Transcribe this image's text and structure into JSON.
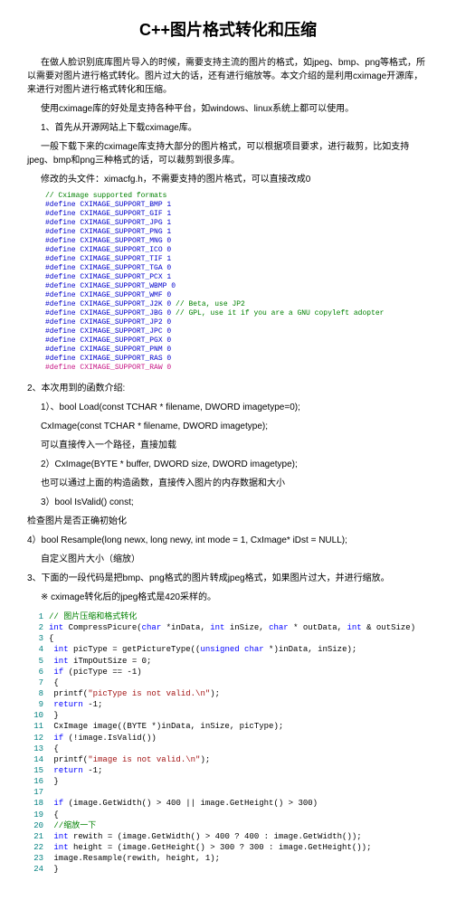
{
  "title": "C++图片格式转化和压缩",
  "intro1": "在做人脸识别底库图片导入的时候，需要支持主流的图片的格式，如jpeg、bmp、png等格式，所以需要对图片进行格式转化。图片过大的话，还有进行缩放等。本文介绍的是利用cximage开源库，来进行对图片进行格式转化和压缩。",
  "intro2": "使用cximage库的好处是支持各种平台，如windows、linux系统上都可以使用。",
  "step1": "1、首先从开源网站上下载cximage库。",
  "step1_note": "一般下载下来的cximage库支持大部分的图片格式，可以根据项目要求，进行裁剪，比如支持jpeg、bmp和png三种格式的话，可以裁剪到很多库。",
  "step1_modify": "修改的头文件：ximacfg.h，不需要支持的图片格式，可以直接改成0",
  "defines": [
    {
      "t": "// Cximage supported formats",
      "cls": "d-green"
    },
    {
      "t": "#define CXIMAGE_SUPPORT_BMP 1",
      "cls": "d-blue"
    },
    {
      "t": "#define CXIMAGE_SUPPORT_GIF 1",
      "cls": "d-blue"
    },
    {
      "t": "#define CXIMAGE_SUPPORT_JPG 1",
      "cls": "d-blue"
    },
    {
      "t": "#define CXIMAGE_SUPPORT_PNG 1",
      "cls": "d-blue"
    },
    {
      "t": "#define CXIMAGE_SUPPORT_MNG 0",
      "cls": "d-blue"
    },
    {
      "t": "#define CXIMAGE_SUPPORT_ICO 0",
      "cls": "d-blue"
    },
    {
      "t": "#define CXIMAGE_SUPPORT_TIF 1",
      "cls": "d-blue"
    },
    {
      "t": "#define CXIMAGE_SUPPORT_TGA 0",
      "cls": "d-blue"
    },
    {
      "t": "#define CXIMAGE_SUPPORT_PCX 1",
      "cls": "d-blue"
    },
    {
      "t": "#define CXIMAGE_SUPPORT_WBMP 0",
      "cls": "d-blue"
    },
    {
      "t": "#define CXIMAGE_SUPPORT_WMF 0",
      "cls": "d-blue"
    },
    {
      "t": "#define CXIMAGE_SUPPORT_J2K 0",
      "cls": "d-blue",
      "extra": "// Beta, use JP2"
    },
    {
      "t": "#define CXIMAGE_SUPPORT_JBG 0",
      "cls": "d-blue",
      "extra": "// GPL, use it if you are a GNU copyleft adopter"
    },
    {
      "t": "#define CXIMAGE_SUPPORT_JP2 0",
      "cls": "d-blue"
    },
    {
      "t": "#define CXIMAGE_SUPPORT_JPC 0",
      "cls": "d-blue"
    },
    {
      "t": "#define CXIMAGE_SUPPORT_PGX 0",
      "cls": "d-blue"
    },
    {
      "t": "#define CXIMAGE_SUPPORT_PNM 0",
      "cls": "d-blue"
    },
    {
      "t": "#define CXIMAGE_SUPPORT_RAS 0",
      "cls": "d-blue"
    },
    {
      "t": "#define CXIMAGE_SUPPORT_RAW 0",
      "cls": "d-pink"
    }
  ],
  "step2": "2、本次用到的函数介绍:",
  "m1_title": "1）、bool Load(const TCHAR * filename, DWORD imagetype=0);",
  "m1_sub1": "CxImage(const TCHAR * filename, DWORD imagetype);",
  "m1_sub2": "可以直接传入一个路径，直接加载",
  "m2_title": "2）CxImage(BYTE * buffer, DWORD size, DWORD imagetype);",
  "m2_sub": "也可以通过上面的构造函数，直接传入图片的内存数据和大小",
  "m3_title": "3）bool IsValid() const;",
  "m3_sub": "检查图片是否正确初始化",
  "m4_title": "4）bool Resample(long newx, long newy, int mode = 1, CxImage* iDst = NULL);",
  "m4_sub": "自定义图片大小（缩放）",
  "step3": "3、下面的一段代码是把bmp、png格式的图片转成jpeg格式，如果图片过大，并进行缩放。",
  "step3_note": "※ cximage转化后的jpeg格式是420采样的。",
  "code": {
    "l1": "// 图片压缩和格式转化",
    "l2_a": "int",
    "l2_b": " CompressPicure(",
    "l2_c": "char",
    "l2_d": " *inData, ",
    "l2_e": "int",
    "l2_f": " inSize, ",
    "l2_g": "char",
    "l2_h": " * outData, ",
    "l2_i": "int",
    "l2_j": " & outSize)",
    "l3": "{",
    "l4_a": "    ",
    "l4_b": "int",
    "l4_c": " picType = getPictureType((",
    "l4_d": "unsigned char",
    "l4_e": " *)inData, inSize);",
    "l5_a": "    ",
    "l5_b": "int",
    "l5_c": " iTmpOutSize = 0;",
    "l6_a": "    ",
    "l6_b": "if",
    "l6_c": " (picType == -1)",
    "l7": "    {",
    "l8_a": "        printf(",
    "l8_b": "\"picType  is not valid.\\n\"",
    "l8_c": ");",
    "l9_a": "        ",
    "l9_b": "return",
    "l9_c": " -1;",
    "l10": "    }",
    "l11": "    CxImage image((BYTE *)inData, inSize, picType);",
    "l12_a": "    ",
    "l12_b": "if",
    "l12_c": " (!image.IsValid())",
    "l13": "    {",
    "l14_a": "        printf(",
    "l14_b": "\"image is not valid.\\n\"",
    "l14_c": ");",
    "l15_a": "        ",
    "l15_b": "return",
    "l15_c": " -1;",
    "l16": "    }",
    "l17": "",
    "l18_a": "    ",
    "l18_b": "if",
    "l18_c": " (image.GetWidth() > 400 || image.GetHeight() > 300)",
    "l19": "    {",
    "l20": "        //缩放一下",
    "l21_a": "        ",
    "l21_b": "int",
    "l21_c": " rewith = (image.GetWidth() > 400 ? 400 : image.GetWidth());",
    "l22_a": "        ",
    "l22_b": "int",
    "l22_c": " height = (image.GetHeight() > 300 ? 300 : image.GetHeight());",
    "l23": "        image.Resample(rewith, height, 1);",
    "l24": "    }"
  }
}
